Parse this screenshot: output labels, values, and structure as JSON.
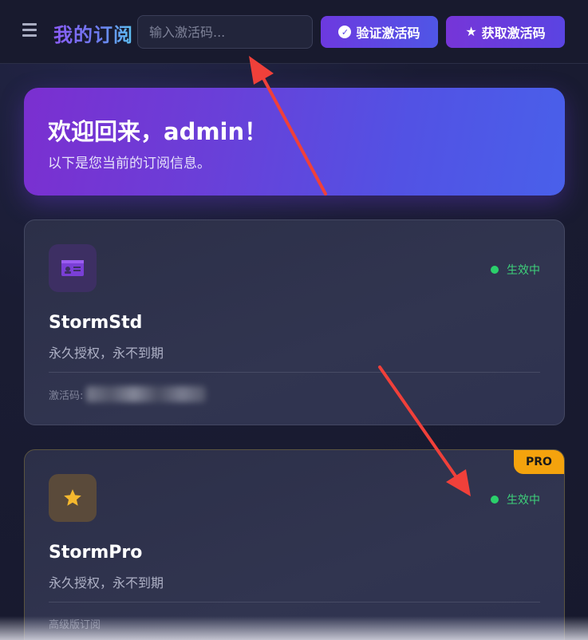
{
  "header": {
    "title": "我的订阅",
    "code_input_placeholder": "输入激活码...",
    "verify_label": "验证激活码",
    "get_label": "获取激活码"
  },
  "welcome": {
    "title": "欢迎回来，admin！",
    "subtitle": "以下是您当前的订阅信息。"
  },
  "subscriptions": [
    {
      "name": "StormStd",
      "status": "生效中",
      "description": "永久授权，永不到期",
      "footer_label": "激活码:",
      "icon": "id-card-icon"
    },
    {
      "name": "StormPro",
      "status": "生效中",
      "description": "永久授权，永不到期",
      "footer_label": "高级版订阅",
      "badge": "PRO",
      "icon": "star-icon"
    }
  ],
  "colors": {
    "accent": "#6a3fd8",
    "status_green": "#2bd06b",
    "pro_badge": "#f4a30d",
    "annotation_arrow": "#f0403a"
  }
}
